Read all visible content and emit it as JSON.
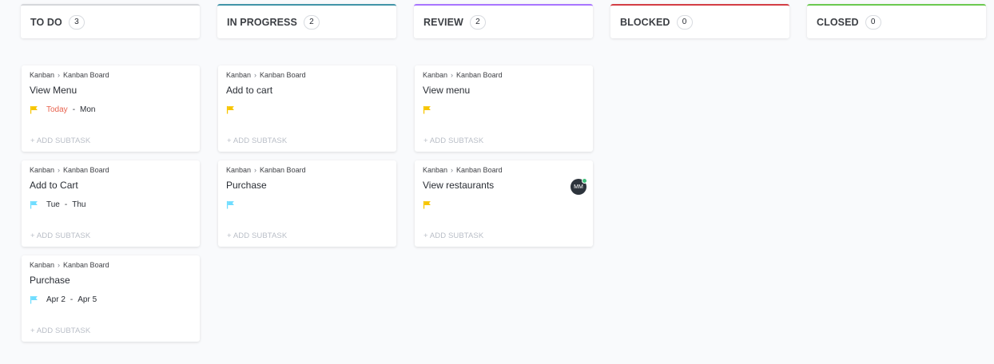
{
  "columns": [
    {
      "title": "TO DO",
      "count": "3",
      "color": "#d5d7db",
      "cards": [
        {
          "crumb_space": "Kanban",
          "crumb_list": "Kanban Board",
          "title": "View Menu",
          "flag_icon": "flag-yellow-icon",
          "flag_color": "#f7c500",
          "start": "Today",
          "start_today": true,
          "end": "Mon",
          "add_subtask": "+ ADD SUBTASK"
        },
        {
          "crumb_space": "Kanban",
          "crumb_list": "Kanban Board",
          "title": "Add to Cart",
          "flag_icon": "flag-cyan-icon",
          "flag_color": "#6fddff",
          "start": "Tue",
          "end": "Thu",
          "add_subtask": "+ ADD SUBTASK"
        },
        {
          "crumb_space": "Kanban",
          "crumb_list": "Kanban Board",
          "title": "Purchase",
          "flag_icon": "flag-cyan-icon",
          "flag_color": "#6fddff",
          "start": "Apr 2",
          "end": "Apr 5",
          "add_subtask": "+ ADD SUBTASK"
        }
      ]
    },
    {
      "title": "IN PROGRESS",
      "count": "2",
      "color": "#4194a8",
      "cards": [
        {
          "crumb_space": "Kanban",
          "crumb_list": "Kanban Board",
          "title": "Add to cart",
          "flag_icon": "flag-yellow-icon",
          "flag_color": "#f7c500",
          "add_subtask": "+ ADD SUBTASK"
        },
        {
          "crumb_space": "Kanban",
          "crumb_list": "Kanban Board",
          "title": "Purchase",
          "flag_icon": "flag-cyan-icon",
          "flag_color": "#6fddff",
          "add_subtask": "+ ADD SUBTASK"
        }
      ]
    },
    {
      "title": "REVIEW",
      "count": "2",
      "color": "#a875ff",
      "cards": [
        {
          "crumb_space": "Kanban",
          "crumb_list": "Kanban Board",
          "title": "View menu",
          "flag_icon": "flag-yellow-icon",
          "flag_color": "#f7c500",
          "add_subtask": "+ ADD SUBTASK"
        },
        {
          "crumb_space": "Kanban",
          "crumb_list": "Kanban Board",
          "title": "View restaurants",
          "flag_icon": "flag-yellow-icon",
          "flag_color": "#f7c500",
          "avatar": "MM",
          "add_subtask": "+ ADD SUBTASK"
        }
      ]
    },
    {
      "title": "BLOCKED",
      "count": "0",
      "color": "#d33d44",
      "cards": []
    },
    {
      "title": "CLOSED",
      "count": "0",
      "color": "#6bc950",
      "cards": []
    }
  ]
}
